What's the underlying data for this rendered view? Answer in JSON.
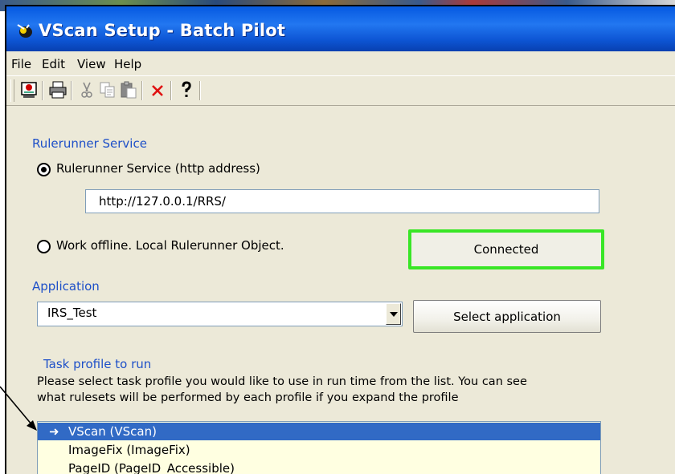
{
  "window": {
    "title": "VScan Setup - Batch Pilot"
  },
  "menu": [
    "File",
    "Edit",
    "View",
    "Help"
  ],
  "toolbar": {
    "icons": [
      "setup-icon",
      "print-icon",
      "cut-icon",
      "copy-icon",
      "paste-icon",
      "delete-icon",
      "help-icon"
    ]
  },
  "service": {
    "group_label": "Rulerunner Service",
    "option_http_label": "Rulerunner Service (http address)",
    "http_address": "http://127.0.0.1/RRS/",
    "option_offline_label": "Work offline. Local Rulerunner Object.",
    "connected_button": "Connected",
    "selected_option": "http"
  },
  "application": {
    "group_label": "Application",
    "selected": "IRS_Test",
    "select_button": "Select application"
  },
  "task_profile": {
    "group_label": "Task profile to run",
    "description_line1": "Please select task profile you would like to use in run time from the list. You can see",
    "description_line2": "what rulesets will be performed by each profile if you expand the profile",
    "items": [
      {
        "label": "VScan  (VScan)",
        "selected": true
      },
      {
        "label": "ImageFix  (ImageFix)",
        "selected": false
      },
      {
        "label": "PageID  (PageID_Accessible)",
        "selected": false
      }
    ]
  },
  "colors": {
    "title_bar": "#0b5fe4",
    "group_label": "#1e50c8",
    "connected_border": "#39e626",
    "selection": "#316ac5",
    "list_background": "#ffffe1"
  }
}
